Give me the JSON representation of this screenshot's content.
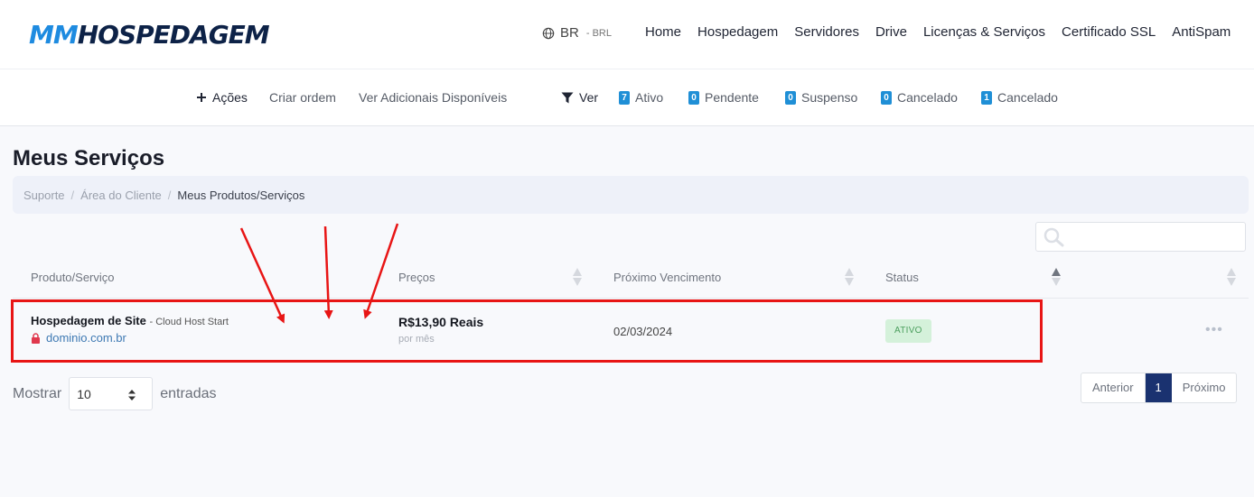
{
  "brand": {
    "logo_part1": "MM",
    "logo_part2": "HOSPEDAGEM"
  },
  "lang": {
    "code": "BR",
    "currency": "- BRL"
  },
  "nav": [
    "Home",
    "Hospedagem",
    "Servidores",
    "Drive",
    "Licenças & Serviços",
    "Certificado SSL",
    "AntiSpam"
  ],
  "subnav": {
    "actions": "Ações",
    "create_order": "Criar ordem",
    "addons": "Ver Adicionais Disponíveis",
    "view": "Ver",
    "filters": [
      {
        "count": "7",
        "label": "Ativo"
      },
      {
        "count": "0",
        "label": "Pendente"
      },
      {
        "count": "0",
        "label": "Suspenso"
      },
      {
        "count": "0",
        "label": "Cancelado"
      },
      {
        "count": "1",
        "label": "Cancelado"
      }
    ]
  },
  "page": {
    "title": "Meus Serviços",
    "breadcrumb": [
      "Suporte",
      "Área do Cliente",
      "Meus Produtos/Serviços"
    ]
  },
  "table": {
    "headers": [
      "Produto/Serviço",
      "Preços",
      "Próximo Vencimento",
      "Status"
    ],
    "rows": [
      {
        "product": "Hospedagem de Site",
        "plan": "- Cloud Host Start",
        "domain": "dominio.com.br",
        "price": "R$13,90 Reais",
        "cycle": "por mês",
        "due": "02/03/2024",
        "status": "ATIVO",
        "more": "•••"
      }
    ]
  },
  "footer": {
    "show_label": "Mostrar",
    "entries_value": "10",
    "entries_label": "entradas",
    "prev": "Anterior",
    "page": "1",
    "next": "Próximo"
  },
  "colors": {
    "brand_blue": "#1e8be0",
    "brand_navy": "#0d2247",
    "highlight": "#e81515",
    "status_active_bg": "#d4f1da"
  }
}
